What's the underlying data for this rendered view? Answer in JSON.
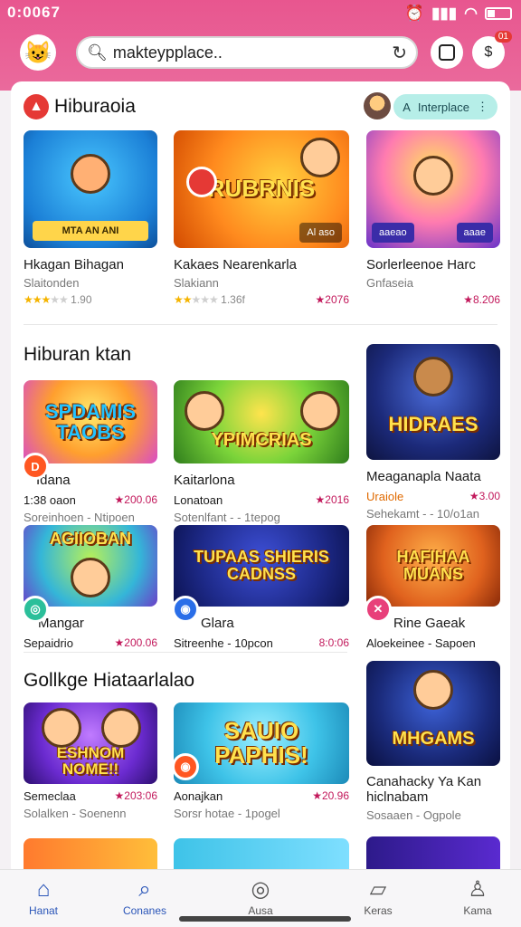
{
  "status_bar": {
    "time": "0:0067"
  },
  "search": {
    "placeholder": "makteypplace.."
  },
  "notifications": {
    "badge": "01"
  },
  "section1": {
    "title": "Hiburaoia",
    "pill_label": "Interplace",
    "cards": [
      {
        "banner": "MTA AN ANI",
        "name": "Hkagan Bihagan",
        "sub": "Slaitonden",
        "rating": "1.90",
        "score": ""
      },
      {
        "title": "RUBRNIS",
        "chip": "Al aso",
        "name": "Kakaes Nearenkarla",
        "sub": "Slakiann",
        "rating": "1.36f",
        "score": "★2076"
      },
      {
        "chip_left": "aaeao",
        "chip_right": "aaae",
        "name": "Sorlerleenoe Harc",
        "sub": "Gnfaseia",
        "rating": "",
        "score": "★8.206"
      }
    ]
  },
  "section2": {
    "title": "Hiburan ktan",
    "row1": [
      {
        "title": "SPDAMIS TAOBS",
        "name": "Idana",
        "meta": "1:38 oaon",
        "score": "★200.06",
        "sub": "Soreinhoen - Ntipoen"
      },
      {
        "title": "YPIMCRIAS",
        "name": "Kaitarlona",
        "meta": "Lonatoan",
        "score": "★2016",
        "sub": "Sotenlfant - - 1tepog"
      },
      {
        "title": "HIDRAES",
        "name": "Meaganapla Naata",
        "meta": "Uraiole",
        "score": "★3.00",
        "sub": "Sehekamt - - 10/o1an"
      }
    ],
    "row2": [
      {
        "title": "AGIIOBAN",
        "name": "Mangar",
        "meta": "Sepaidrio",
        "score": "★200.06",
        "sub": ""
      },
      {
        "title": "TUPAAS SHIERIS CADNSS",
        "name": "Glara",
        "meta": "Sitreenhe - 10pcon",
        "score": "8:0:06",
        "sub": ""
      },
      {
        "title": "HAFIHAA MUANS",
        "name": "Rine Gaeak",
        "meta": "Aloekeinee - Sapoen",
        "score": "",
        "sub": ""
      }
    ]
  },
  "section3": {
    "title": "Gollkge Hiataarlalao",
    "cards": [
      {
        "title": "ESHNOM NOME!!",
        "name": "Semeclaa",
        "score": "★203:06",
        "sub": "Solalken - Soenenn"
      },
      {
        "title": "SAUIO PAPHIS!",
        "name": "Aonajkan",
        "score": "★20.96",
        "sub": "Sorsr hotae - 1pogel"
      },
      {
        "title": "MHGAMS",
        "name": "Canahacky Ya Kan hiclnabam",
        "score": "",
        "sub": "Sosaaen - Ogpole"
      }
    ]
  },
  "bottom_nav": [
    {
      "label": "Hanat",
      "icon": "home-icon"
    },
    {
      "label": "Conanes",
      "icon": "search-icon"
    },
    {
      "label": "Ausa",
      "icon": "compass-icon"
    },
    {
      "label": "Keras",
      "icon": "bookmark-icon"
    },
    {
      "label": "Kama",
      "icon": "profile-icon"
    }
  ],
  "colors": {
    "accent": "#e8568f",
    "active": "#2a55b8",
    "rating": "#c2185b"
  }
}
